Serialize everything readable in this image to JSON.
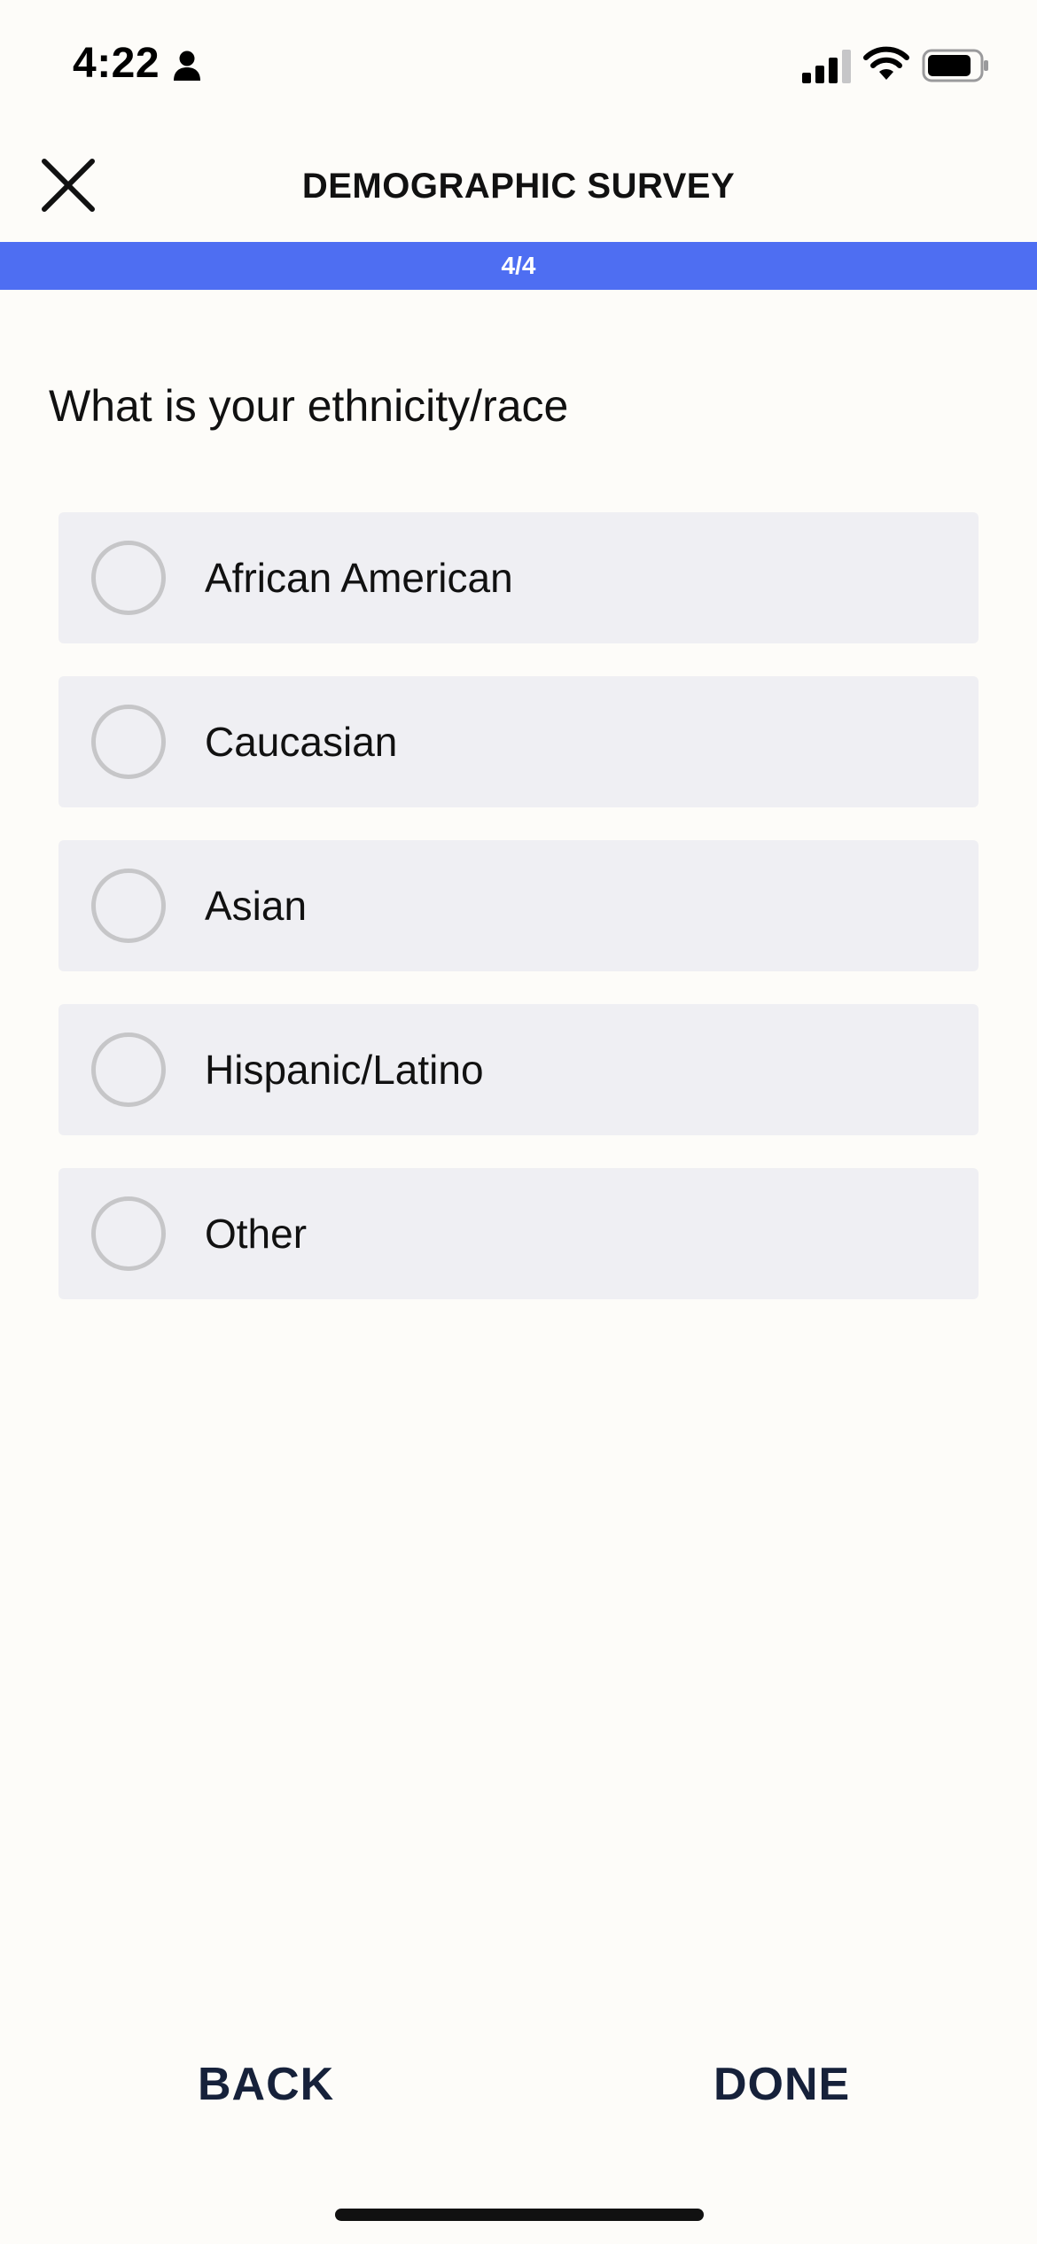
{
  "status_bar": {
    "time": "4:22"
  },
  "header": {
    "title": "DEMOGRAPHIC SURVEY",
    "close_icon": "close-icon"
  },
  "progress": {
    "label": "4/4",
    "fraction": 1.0,
    "color": "#4e6ef2"
  },
  "question": {
    "text": "What is your ethnicity/race"
  },
  "options": [
    {
      "label": "African American",
      "selected": false
    },
    {
      "label": "Caucasian",
      "selected": false
    },
    {
      "label": "Asian",
      "selected": false
    },
    {
      "label": "Hispanic/Latino",
      "selected": false
    },
    {
      "label": "Other",
      "selected": false
    }
  ],
  "nav": {
    "back_label": "BACK",
    "done_label": "DONE"
  },
  "colors": {
    "background": "#fdfcf9",
    "option_background": "#efeff3",
    "nav_text": "#16213a",
    "accent": "#4e6ef2"
  }
}
